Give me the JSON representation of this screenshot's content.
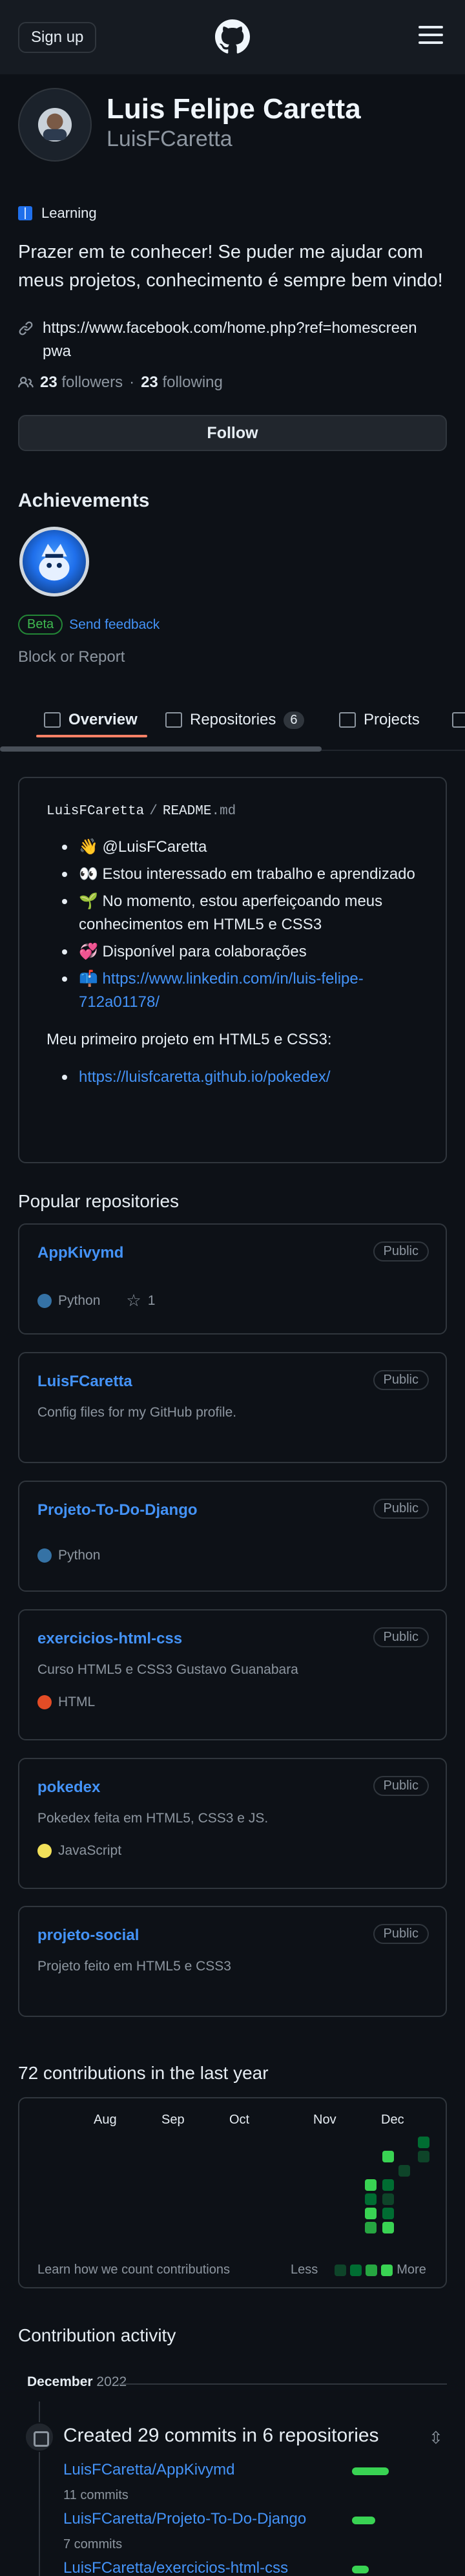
{
  "header": {
    "signup_label": "Sign up"
  },
  "profile": {
    "name": "Luis Felipe Caretta",
    "login": "LuisFCaretta",
    "status": "Learning",
    "bio": "Prazer em te conhecer! Se puder me ajudar com meus projetos, conhecimento é sempre bem vindo!",
    "website": "https://www.facebook.com/home.php?ref=homescreenpwa",
    "followers_count": "23",
    "followers_label": "followers",
    "following_count": "23",
    "following_label": "following",
    "separator": "·",
    "follow_label": "Follow"
  },
  "achievements": {
    "title": "Achievements",
    "beta_label": "Beta",
    "feedback_label": "Send feedback",
    "block_label": "Block or Report"
  },
  "tabs": [
    {
      "label": "Overview",
      "icon": "book-icon"
    },
    {
      "label": "Repositories",
      "counter": "6",
      "icon": "repo-icon"
    },
    {
      "label": "Projects",
      "icon": "table-icon"
    }
  ],
  "readme": {
    "owner": "LuisFCaretta",
    "separator": "/",
    "file": "README",
    "ext": ".md",
    "items": [
      "👋 @LuisFCaretta",
      "👀 Estou interessado em trabalho e aprendizado",
      "🌱 No momento, estou aperfeiçoando meus conhecimentos em HTML5 e CSS3",
      "💞️ Disponível para colaborações",
      "📫 https://www.linkedin.com/in/luis-felipe-712a01178/"
    ],
    "project_text": "Meu primeiro projeto em HTML5 e CSS3:",
    "project_link": "https://luisfcaretta.github.io/pokedex/"
  },
  "popular": {
    "title": "Popular repositories",
    "repos": [
      {
        "name": "AppKivymd",
        "visibility": "Public",
        "description": "",
        "language": "Python",
        "lang_color": "#3572A5",
        "stars": "1"
      },
      {
        "name": "LuisFCaretta",
        "visibility": "Public",
        "description": "Config files for my GitHub profile.",
        "language": "",
        "lang_color": "",
        "stars": ""
      },
      {
        "name": "Projeto-To-Do-Django",
        "visibility": "Public",
        "description": "",
        "language": "Python",
        "lang_color": "#3572A5",
        "stars": ""
      },
      {
        "name": "exercicios-html-css",
        "visibility": "Public",
        "description": "Curso HTML5 e CSS3 Gustavo Guanabara",
        "language": "HTML",
        "lang_color": "#e34c26",
        "stars": ""
      },
      {
        "name": "pokedex",
        "visibility": "Public",
        "description": "Pokedex feita em HTML5, CSS3 e JS.",
        "language": "JavaScript",
        "lang_color": "#f1e05a",
        "stars": ""
      },
      {
        "name": "projeto-social",
        "visibility": "Public",
        "description": "Projeto feito em HTML5 e CSS3",
        "language": "",
        "lang_color": "",
        "stars": ""
      }
    ]
  },
  "contributions": {
    "title": "72 contributions in the last year",
    "months": [
      "Aug",
      "Sep",
      "Oct",
      "Nov",
      "Dec"
    ],
    "learn_label": "Learn how we count contributions",
    "less_label": "Less",
    "more_label": "More",
    "level_colors": [
      "#0e4429",
      "#006d32",
      "#26a641",
      "#39d353"
    ]
  },
  "activity": {
    "title": "Contribution activity",
    "month": "December",
    "year": "2022",
    "heading": "Created 29 commits in 6 repositories",
    "repos": [
      {
        "name": "LuisFCaretta/AppKivymd",
        "commits": "11 commits",
        "share": 0.38
      },
      {
        "name": "LuisFCaretta/Projeto-To-Do-Django",
        "commits": "7 commits",
        "share": 0.24
      },
      {
        "name": "LuisFCaretta/exercicios-html-css",
        "commits": "",
        "share": 0.17
      }
    ]
  }
}
